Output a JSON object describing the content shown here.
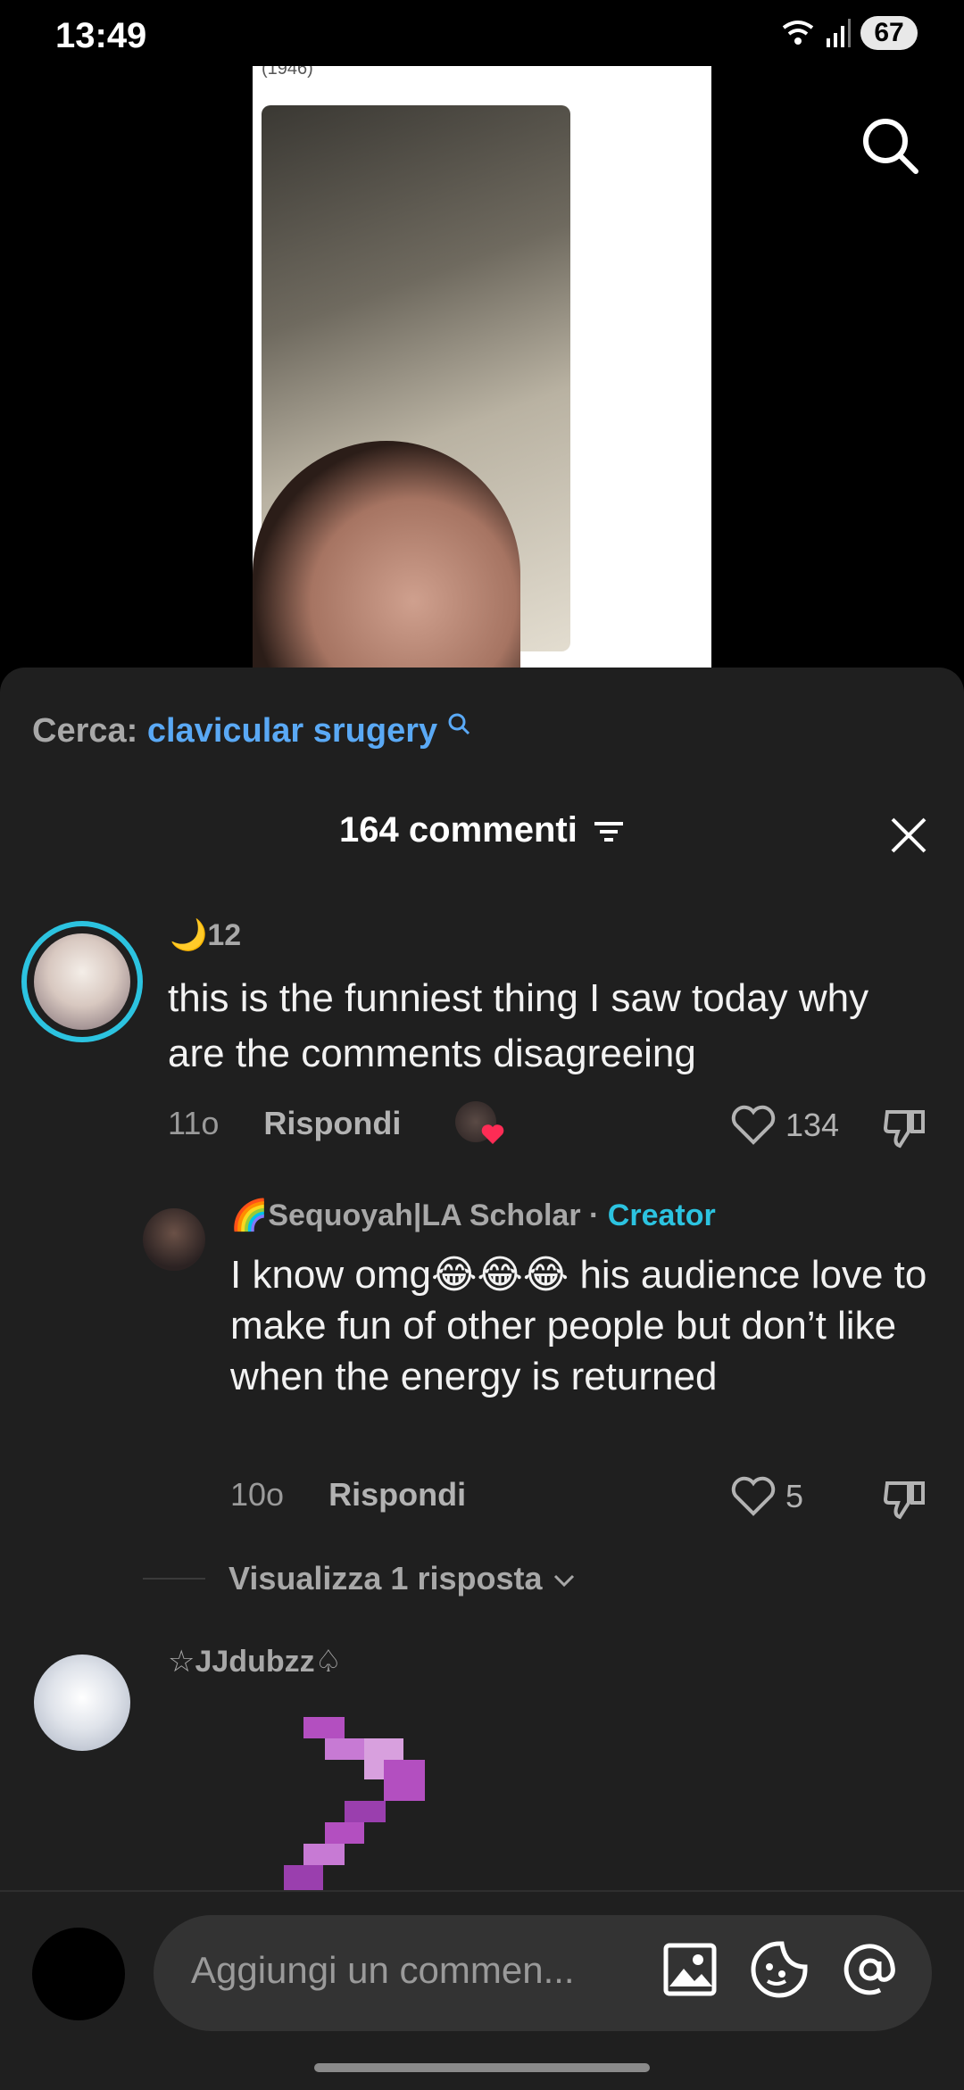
{
  "status": {
    "time": "13:49",
    "battery": "67"
  },
  "video": {
    "caption": "(1946)"
  },
  "sheet": {
    "search_prefix": "Cerca:",
    "search_query": "clavicular srugery",
    "comments_count": "164 commenti"
  },
  "comments": [
    {
      "username": "🌙12",
      "text": "this is the funniest thing I saw today why are the comments disagreeing",
      "age": "11o",
      "reply_label": "Rispondi",
      "likes": "134"
    },
    {
      "username": "🌈Sequoyah|LA Scholar",
      "separator": "·",
      "badge": "Creator",
      "text": "I know omg😂😂😂 his audience love to make fun of other people but don’t like when the energy is returned",
      "age": "10o",
      "reply_label": "Rispondi",
      "likes": "5",
      "view_replies": "Visualizza 1 risposta"
    },
    {
      "username": "☆JJdubzz♤"
    }
  ],
  "composer": {
    "placeholder": "Aggiungi un commen..."
  },
  "colors": {
    "accent": "#2cc3e0",
    "link": "#5aa9f5",
    "sheet_bg": "#1f1f1f"
  }
}
